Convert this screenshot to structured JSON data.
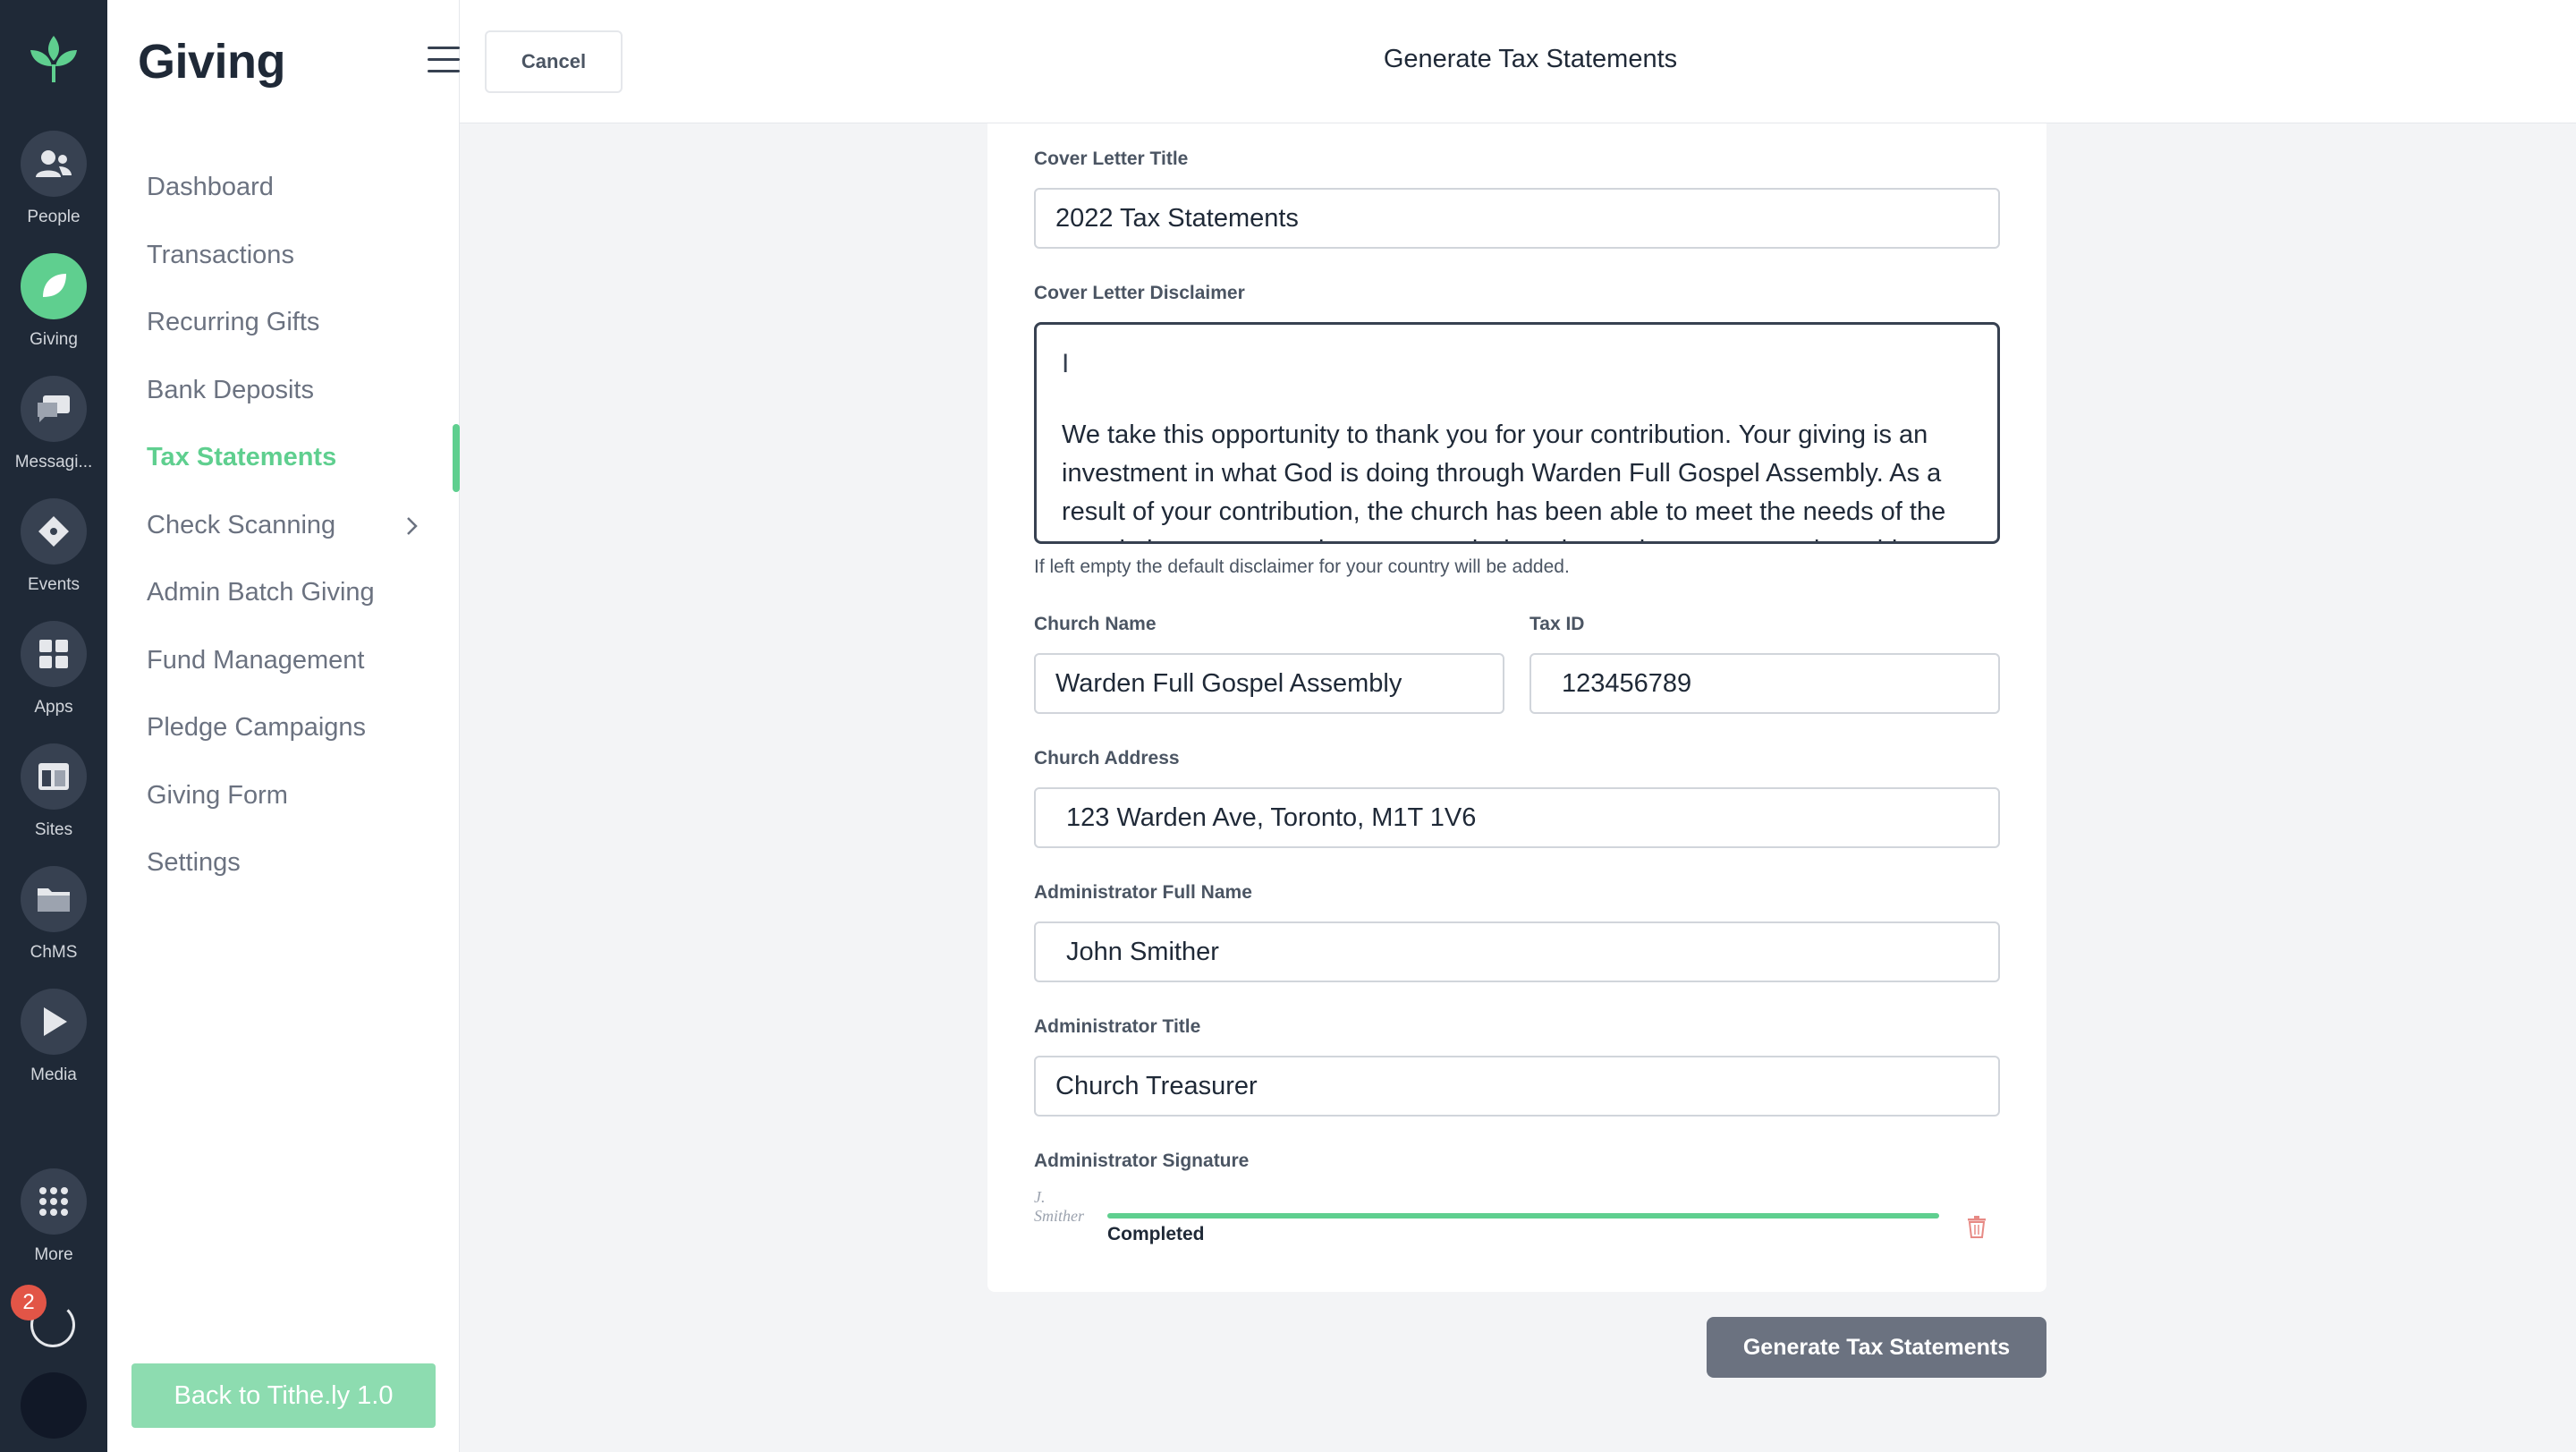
{
  "rail": {
    "items": [
      {
        "label": "People",
        "icon": "people-icon"
      },
      {
        "label": "Giving",
        "icon": "giving-leaf-icon",
        "active": true
      },
      {
        "label": "Messagi...",
        "icon": "message-icon"
      },
      {
        "label": "Events",
        "icon": "ticket-icon"
      },
      {
        "label": "Apps",
        "icon": "apps-grid-icon"
      },
      {
        "label": "Sites",
        "icon": "sites-icon"
      },
      {
        "label": "ChMS",
        "icon": "folder-icon"
      },
      {
        "label": "Media",
        "icon": "play-icon"
      },
      {
        "label": "More",
        "icon": "more-dots-icon"
      }
    ],
    "notification_count": "2"
  },
  "sidebar": {
    "title": "Giving",
    "items": [
      {
        "label": "Dashboard"
      },
      {
        "label": "Transactions"
      },
      {
        "label": "Recurring Gifts"
      },
      {
        "label": "Bank Deposits"
      },
      {
        "label": "Tax Statements",
        "active": true
      },
      {
        "label": "Check Scanning",
        "has_submenu": true
      },
      {
        "label": "Admin Batch Giving"
      },
      {
        "label": "Fund Management"
      },
      {
        "label": "Pledge Campaigns"
      },
      {
        "label": "Giving Form"
      },
      {
        "label": "Settings"
      }
    ],
    "back_button": "Back to Tithe.ly 1.0"
  },
  "header": {
    "cancel_label": "Cancel",
    "title": "Generate Tax Statements"
  },
  "form": {
    "cover_title_label": "Cover Letter Title",
    "cover_title_value": "2022 Tax Statements",
    "disclaimer_label": "Cover Letter Disclaimer",
    "disclaimer_value": "We take this opportunity to thank you for your contribution. Your giving is an investment in what God is doing through Warden Full Gospel Assembly. As a result of your contribution, the church has been able to meet the needs of the people in our community, support missionaries and programs, and provide",
    "disclaimer_helper": "If left empty the default disclaimer for your country will be added.",
    "church_name_label": "Church Name",
    "church_name_value": "Warden Full Gospel Assembly",
    "tax_id_label": "Tax ID",
    "tax_id_value": "123456789",
    "church_address_label": "Church Address",
    "church_address_value": "123 Warden Ave, Toronto, M1T 1V6",
    "admin_name_label": "Administrator Full Name",
    "admin_name_value": "John Smither",
    "admin_title_label": "Administrator Title",
    "admin_title_value": "Church Treasurer",
    "signature_label": "Administrator Signature",
    "signature_image_text": "J. Smither",
    "upload_progress": 1.0,
    "upload_status": "Completed"
  },
  "footer": {
    "generate_label": "Generate Tax Statements"
  },
  "colors": {
    "accent": "#5fcf8f",
    "rail_bg": "#1f2937",
    "button_gray": "#6b7280"
  }
}
